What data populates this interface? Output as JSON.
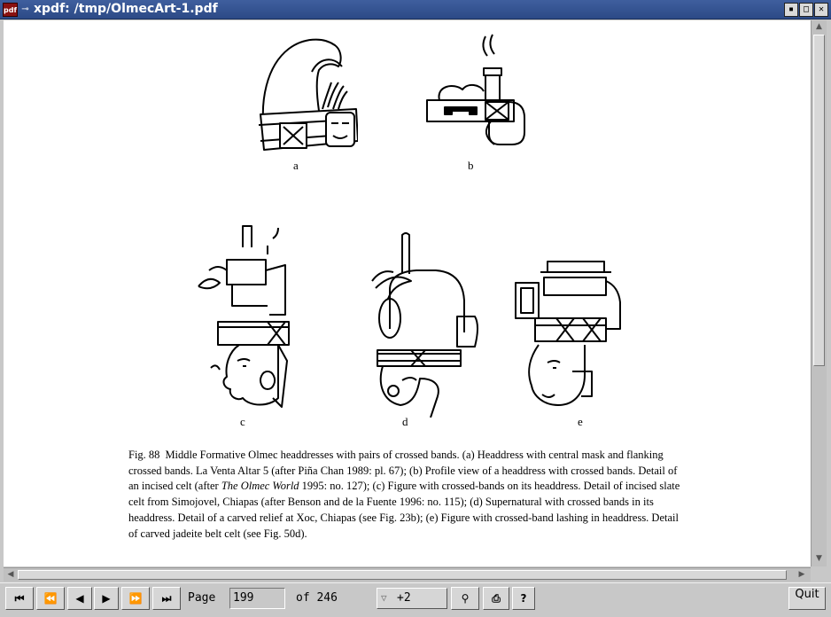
{
  "window": {
    "app_icon_text": "pdf",
    "title": "xpdf: /tmp/OlmecArt-1.pdf"
  },
  "figure": {
    "labels": [
      "a",
      "b",
      "c",
      "d",
      "e"
    ],
    "caption_number": "Fig. 88",
    "caption_text_1": "Middle Formative Olmec headdresses with pairs of crossed bands. (a) Headdress with central mask and flanking crossed bands. La Venta Altar 5 (after Piña Chan 1989: pl. 67); (b) Profile view of a headdress with crossed bands. Detail of an incised celt (after ",
    "caption_italic": "The Olmec World",
    "caption_text_2": " 1995: no. 127); (c) Figure with crossed-bands on its headdress. Detail of incised slate celt from Simojovel, Chiapas (after Benson and de la Fuente 1996: no. 115); (d) Supernatural with crossed bands in its headdress. Detail of a carved relief at Xoc, Chiapas (see Fig. 23b); (e) Figure with crossed-band lashing in headdress. Detail of carved jadeite belt celt (see Fig. 50d)."
  },
  "toolbar": {
    "page_label": "Page",
    "page_value": "199",
    "of_label": "of 246",
    "zoom_value": "+2",
    "quit_label": "Quit"
  }
}
